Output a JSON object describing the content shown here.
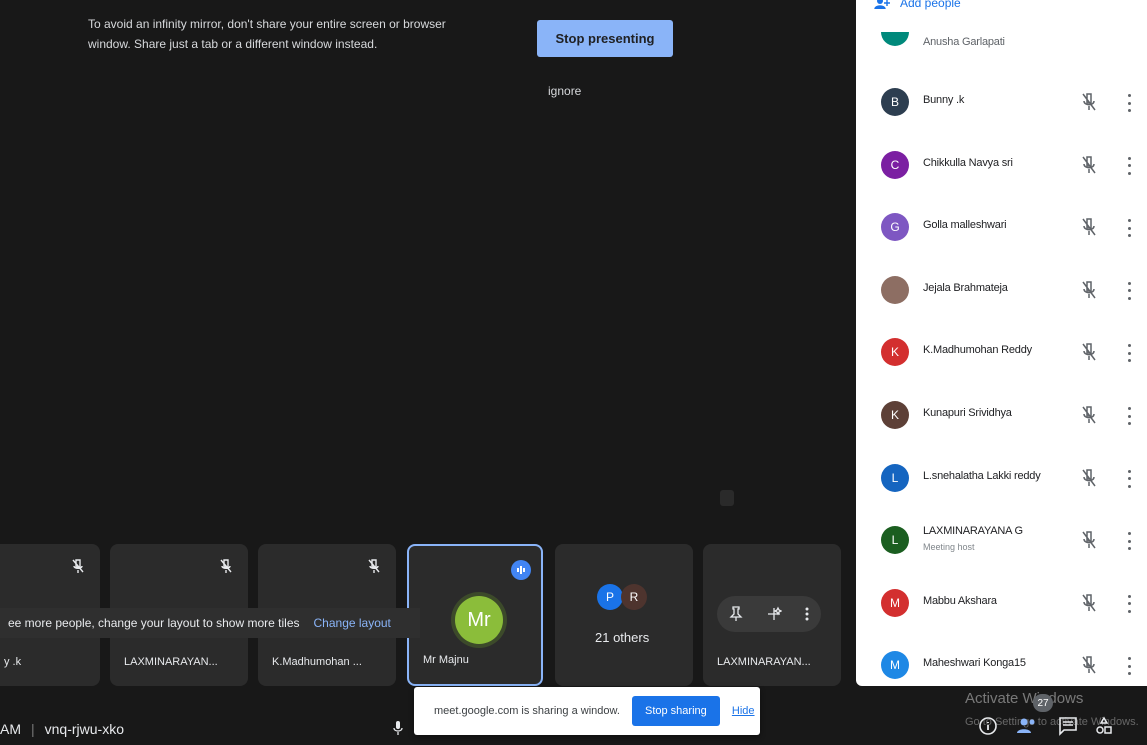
{
  "banner": {
    "warning_line1": "To avoid an infinity mirror, don't share your entire screen or browser",
    "warning_line2": "window. Share just a tab or a different window instead.",
    "stop_presenting": "Stop presenting",
    "ignore": "ignore"
  },
  "tiles": [
    {
      "name": "y .k"
    },
    {
      "name": "LAXMINARAYAN..."
    },
    {
      "name": "K.Madhumohan ..."
    },
    {
      "name": "Mr Majnu",
      "initials": "Mr"
    },
    {
      "others": "21 others",
      "av1": "P",
      "av2": "R"
    },
    {
      "name": "LAXMINARAYAN..."
    }
  ],
  "hint": {
    "text": "ee more people, change your layout to show more tiles",
    "link": "Change layout"
  },
  "bottom": {
    "time": "AM",
    "meeting_code": "vnq-rjwu-xko"
  },
  "sharebar": {
    "text": "meet.google.com is sharing a window.",
    "stop": "Stop sharing",
    "hide": "Hide"
  },
  "watermark": {
    "line1": "Activate Windows",
    "line2": "Go to Settings to activate Windows."
  },
  "people_count": "27",
  "panel": {
    "add_people": "Add people",
    "partial_name": "Anusha Garlapati",
    "people": [
      {
        "initial": "B",
        "name": "Bunny .k",
        "color": "#2d3e50"
      },
      {
        "initial": "C",
        "name": "Chikkulla Navya sri",
        "color": "#7b1fa2"
      },
      {
        "initial": "G",
        "name": "Golla malleshwari",
        "color": "#7e57c2"
      },
      {
        "initial": "",
        "name": "Jejala Brahmateja",
        "color": "#8d6e63"
      },
      {
        "initial": "K",
        "name": "K.Madhumohan Reddy",
        "color": "#d32f2f"
      },
      {
        "initial": "K",
        "name": "Kunapuri Srividhya",
        "color": "#5d4037"
      },
      {
        "initial": "L",
        "name": "L.snehalatha Lakki reddy",
        "color": "#1565c0"
      },
      {
        "initial": "L",
        "name": "LAXMINARAYANA G",
        "sub": "Meeting host",
        "color": "#1b5e20"
      },
      {
        "initial": "M",
        "name": "Mabbu Akshara",
        "color": "#d32f2f"
      },
      {
        "initial": "M",
        "name": "Maheshwari Konga15",
        "color": "#1e88e5"
      }
    ]
  }
}
